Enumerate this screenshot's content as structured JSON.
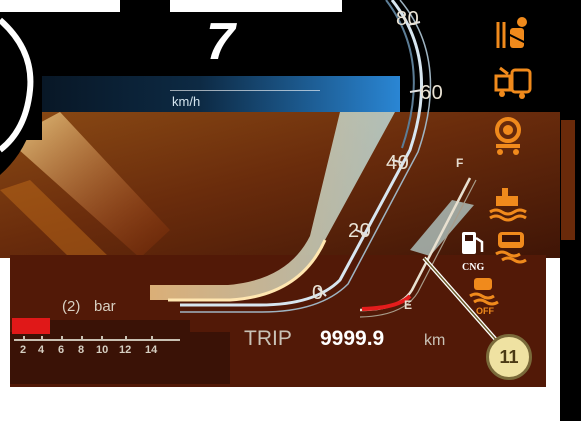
{
  "header": {
    "speed_digit": "7",
    "unit_label": "km/h"
  },
  "speed_scale": {
    "labels": [
      "80",
      "60",
      "40",
      "20",
      "0"
    ]
  },
  "fuel_gauge": {
    "full_label": "F",
    "empty_label": "E"
  },
  "pressure": {
    "circuit_label": "(2)",
    "unit_label": "bar",
    "scale_ticks": [
      "2",
      "4",
      "6",
      "8",
      "10",
      "12",
      "14"
    ]
  },
  "trip": {
    "label": "TRIP",
    "value": "9999.9",
    "unit": "km"
  },
  "indicators": {
    "cng_label": "CNG",
    "off_label": "OFF"
  },
  "callout": {
    "number": "11"
  },
  "colors": {
    "amber": "#f08a1c",
    "panel_brown": "#5a1c08",
    "needle_red": "#d81818",
    "scale_blue": "#3a9ee8"
  },
  "icons": {
    "driver_seatbelt": "seatbelt-warning-icon",
    "trailer_system": "trailer-warning-icon",
    "brake_lining": "brake-lining-wear-icon",
    "low_coolant": "coolant-level-icon",
    "fuel_pump": "fuel-pump-icon",
    "vehicle_slip": "traction-control-icon",
    "slip_off": "traction-control-off-icon"
  }
}
